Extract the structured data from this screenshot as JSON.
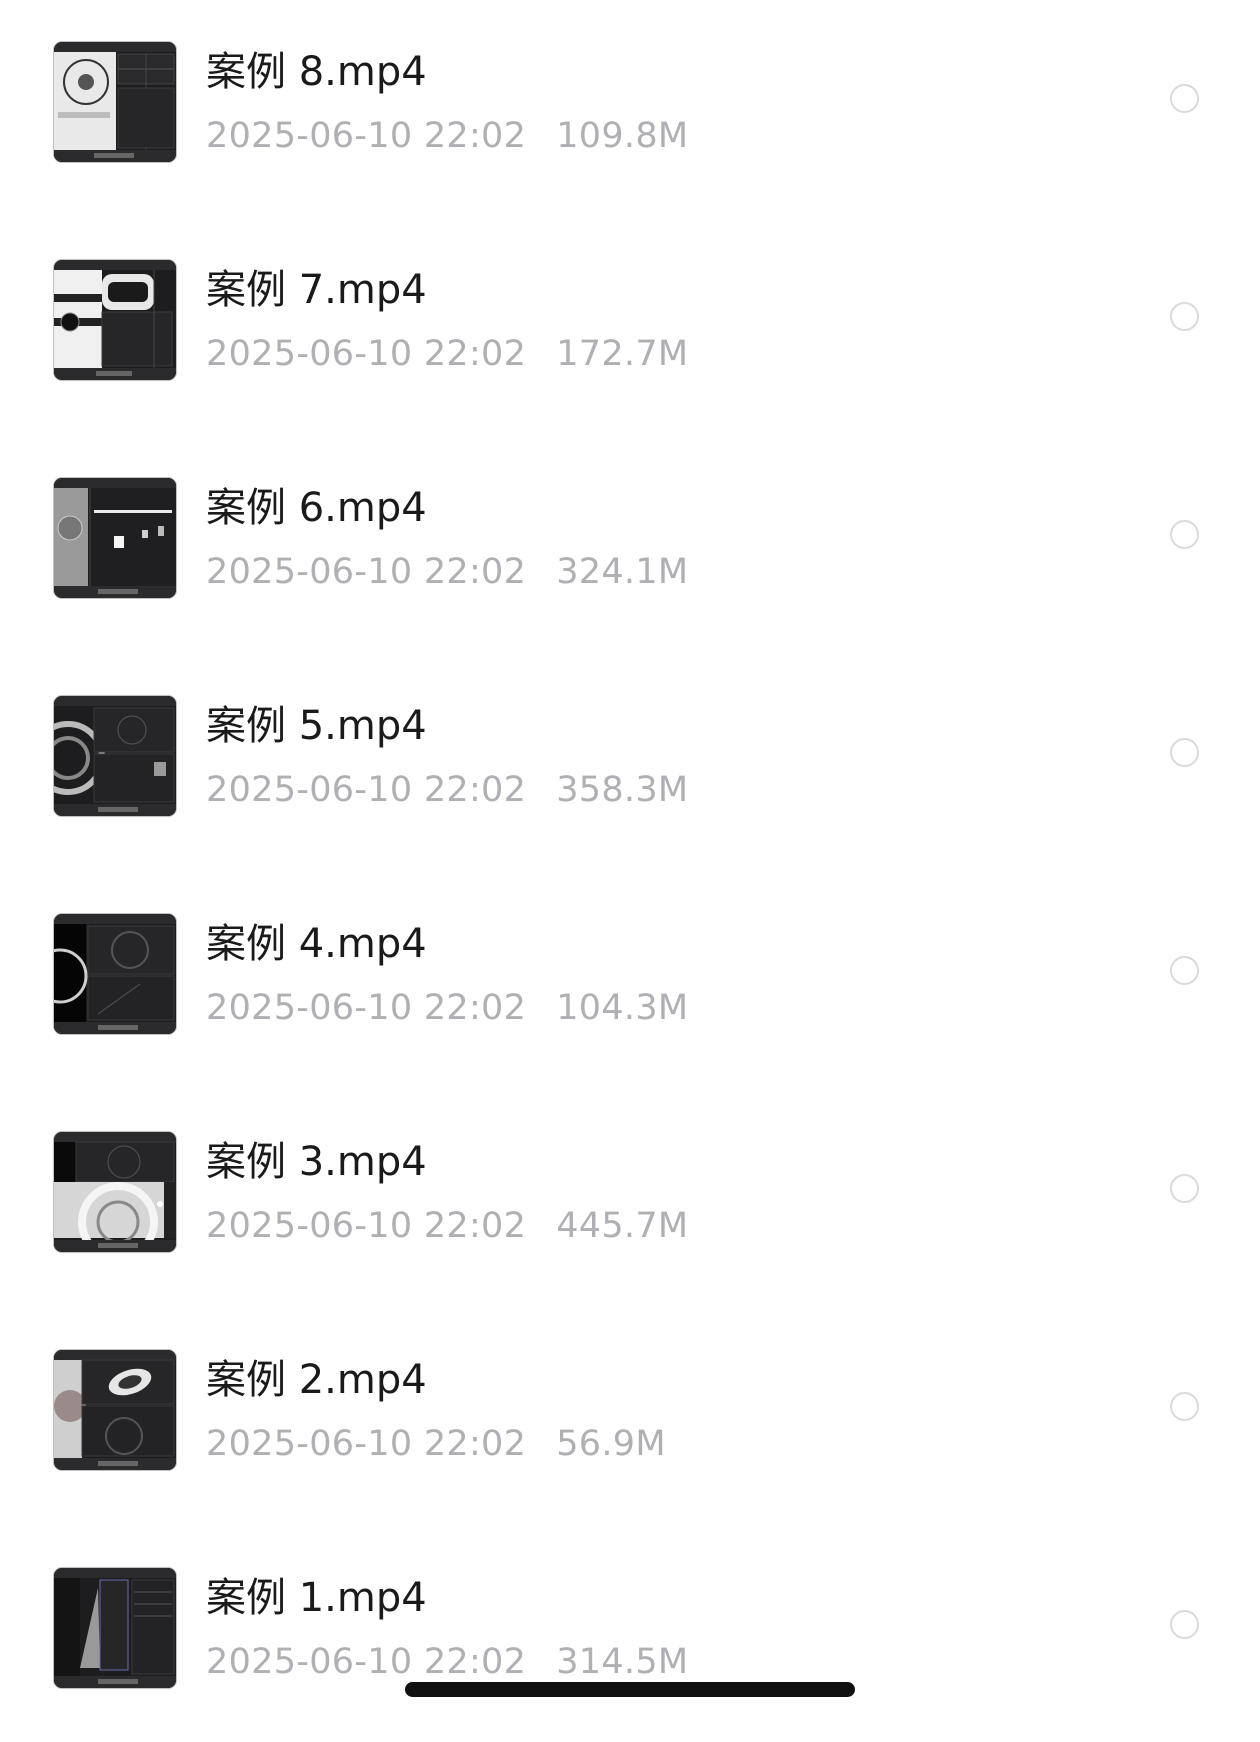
{
  "files": [
    {
      "name": "案例 8.mp4",
      "date": "2025-06-10 22:02",
      "size": "109.8M",
      "thumbnail_icon": "video-thumbnail-icon"
    },
    {
      "name": "案例 7.mp4",
      "date": "2025-06-10 22:02",
      "size": "172.7M",
      "thumbnail_icon": "video-thumbnail-icon"
    },
    {
      "name": "案例 6.mp4",
      "date": "2025-06-10 22:02",
      "size": "324.1M",
      "thumbnail_icon": "video-thumbnail-icon"
    },
    {
      "name": "案例 5.mp4",
      "date": "2025-06-10 22:02",
      "size": "358.3M",
      "thumbnail_icon": "video-thumbnail-icon"
    },
    {
      "name": "案例 4.mp4",
      "date": "2025-06-10 22:02",
      "size": "104.3M",
      "thumbnail_icon": "video-thumbnail-icon"
    },
    {
      "name": "案例 3.mp4",
      "date": "2025-06-10 22:02",
      "size": "445.7M",
      "thumbnail_icon": "video-thumbnail-icon"
    },
    {
      "name": "案例 2.mp4",
      "date": "2025-06-10 22:02",
      "size": "56.9M",
      "thumbnail_icon": "video-thumbnail-icon"
    },
    {
      "name": "案例 1.mp4",
      "date": "2025-06-10 22:02",
      "size": "314.5M",
      "thumbnail_icon": "video-thumbnail-icon"
    }
  ],
  "colors": {
    "background": "#ffffff",
    "name_text": "#1a1a1a",
    "meta_text": "#b0b0b4",
    "radio_border": "#dadadd",
    "home_indicator": "#111111"
  }
}
